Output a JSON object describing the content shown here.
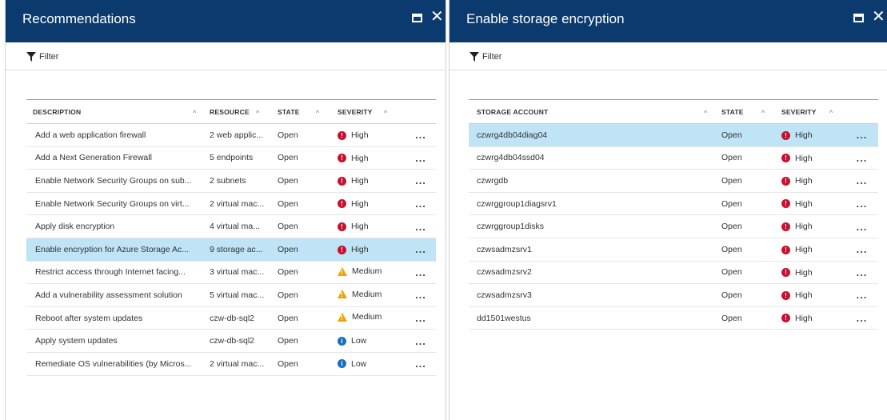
{
  "left_blade": {
    "title": "Recommendations",
    "filter_label": "Filter",
    "columns": [
      "DESCRIPTION",
      "RESOURCE",
      "STATE",
      "SEVERITY"
    ],
    "rows": [
      {
        "description": "Add a web application firewall",
        "resource": "2 web applic...",
        "state": "Open",
        "severity": "High"
      },
      {
        "description": "Add a Next Generation Firewall",
        "resource": "5 endpoints",
        "state": "Open",
        "severity": "High"
      },
      {
        "description": "Enable Network Security Groups on sub...",
        "resource": "2 subnets",
        "state": "Open",
        "severity": "High"
      },
      {
        "description": "Enable Network Security Groups on virt...",
        "resource": "2 virtual mac...",
        "state": "Open",
        "severity": "High"
      },
      {
        "description": "Apply disk encryption",
        "resource": "4 virtual ma...",
        "state": "Open",
        "severity": "High"
      },
      {
        "description": "Enable encryption for Azure Storage Ac...",
        "resource": "9 storage ac...",
        "state": "Open",
        "severity": "High",
        "selected": true
      },
      {
        "description": "Restrict access through Internet facing...",
        "resource": "3 virtual mac...",
        "state": "Open",
        "severity": "Medium"
      },
      {
        "description": "Add a vulnerability assessment solution",
        "resource": "5 virtual mac...",
        "state": "Open",
        "severity": "Medium"
      },
      {
        "description": "Reboot after system updates",
        "resource": "czw-db-sql2",
        "state": "Open",
        "severity": "Medium"
      },
      {
        "description": "Apply system updates",
        "resource": "czw-db-sql2",
        "state": "Open",
        "severity": "Low"
      },
      {
        "description": "Remediate OS vulnerabilities (by Micros...",
        "resource": "2 virtual mac...",
        "state": "Open",
        "severity": "Low"
      }
    ]
  },
  "right_blade": {
    "title": "Enable storage encryption",
    "filter_label": "Filter",
    "columns": [
      "STORAGE ACCOUNT",
      "STATE",
      "SEVERITY"
    ],
    "rows": [
      {
        "account": "czwrg4db04diag04",
        "state": "Open",
        "severity": "High",
        "selected": true
      },
      {
        "account": "czwrg4db04ssd04",
        "state": "Open",
        "severity": "High"
      },
      {
        "account": "czwrgdb",
        "state": "Open",
        "severity": "High"
      },
      {
        "account": "czwrggroup1diagsrv1",
        "state": "Open",
        "severity": "High"
      },
      {
        "account": "czwrggroup1disks",
        "state": "Open",
        "severity": "High"
      },
      {
        "account": "czwsadmzsrv1",
        "state": "Open",
        "severity": "High"
      },
      {
        "account": "czwsadmzsrv2",
        "state": "Open",
        "severity": "High"
      },
      {
        "account": "czwsadmzsrv3",
        "state": "Open",
        "severity": "High"
      },
      {
        "account": "dd1501westus",
        "state": "Open",
        "severity": "High"
      }
    ]
  },
  "ui": {
    "maximize_glyph": "",
    "close_glyph": "✕",
    "sort_glyph": "^",
    "more_glyph": "...",
    "colors": {
      "header_bg": "#0b3a6e",
      "selected_row": "#bfe4f5",
      "high": "#c8102e",
      "medium": "#f0a200",
      "low": "#1b6ec2"
    }
  }
}
